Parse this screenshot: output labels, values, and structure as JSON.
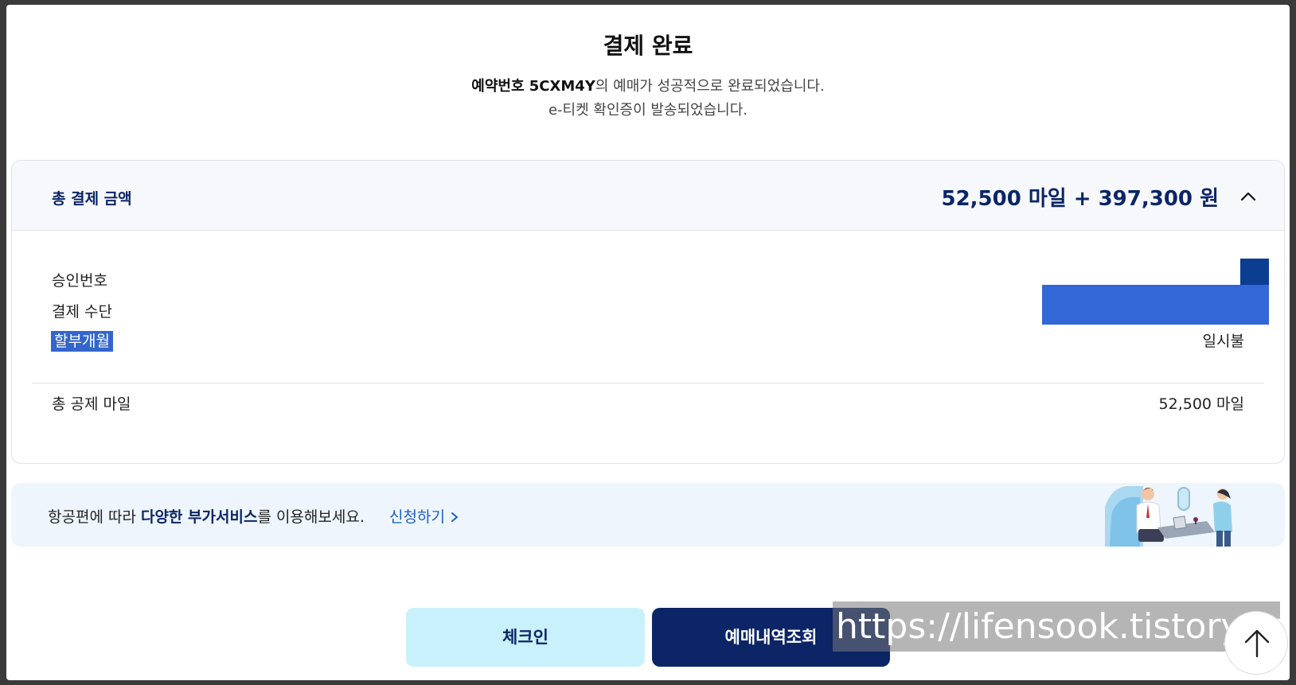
{
  "header": {
    "title": "결제 완료",
    "line1_bold": "예약번호 5CXM4Y",
    "line1_rest": "의 예매가 성공적으로 완료되었습니다.",
    "line2": "e-티켓 확인증이 발송되었습니다."
  },
  "summary": {
    "label": "총 결제 금액",
    "amount": "52,500 마일 + 397,300 원",
    "toggle_icon": "chevron-up-icon"
  },
  "details": {
    "approval_label": "승인번호",
    "method_label": "결제 수단",
    "installment_label": "할부개월",
    "installment_value": "일시불",
    "miles_label": "총 공제 마일",
    "miles_value": "52,500 마일"
  },
  "banner": {
    "text_pre": "항공편에 따라 ",
    "text_bold": "다양한 부가서비스",
    "text_post": "를 이용해보세요.",
    "link": "신청하기"
  },
  "actions": {
    "checkin": "체크인",
    "booking": "예매내역조회"
  },
  "watermark": "https://lifensook.tistory.com",
  "colors": {
    "navy": "#0b2566",
    "light_cyan": "#c9f1fc",
    "link_blue": "#1a5dc7",
    "highlight": "#3366cc"
  }
}
